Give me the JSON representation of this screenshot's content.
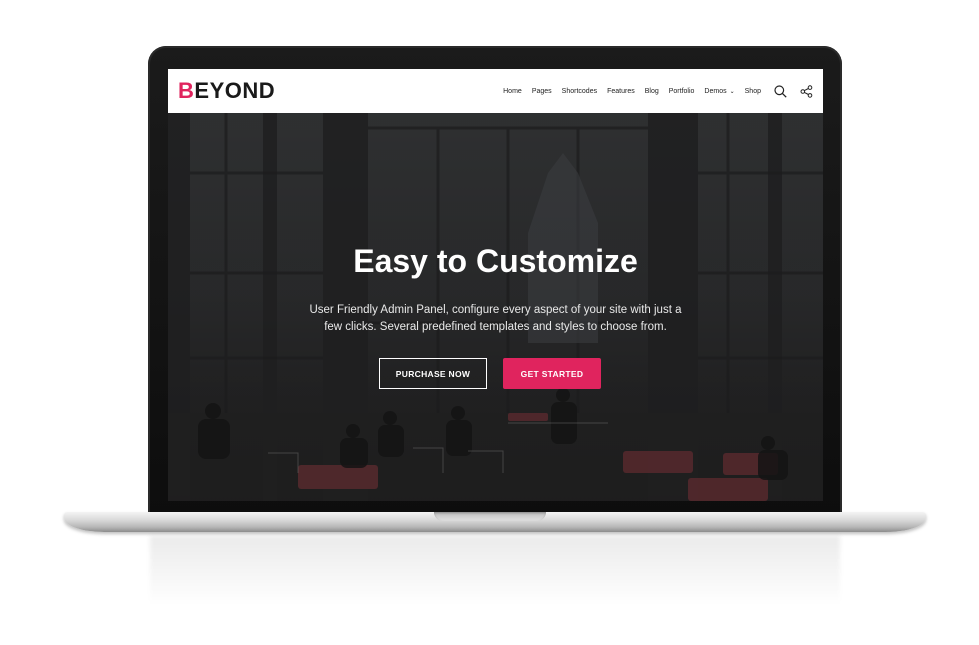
{
  "site": {
    "logo_first": "B",
    "logo_rest": "EYOND",
    "accent_color": "#e0245e"
  },
  "nav": {
    "items": [
      "Home",
      "Pages",
      "Shortcodes",
      "Features",
      "Blog",
      "Portfolio",
      "Demos",
      "Shop"
    ],
    "demos_caret": "⌄",
    "icons": [
      "search-icon",
      "share-icon"
    ]
  },
  "hero": {
    "title": "Easy to Customize",
    "subtitle": "User Friendly Admin Panel, configure every aspect of your site with just a few clicks. Several predefined templates and styles to choose from.",
    "purchase_label": "PURCHASE NOW",
    "get_started_label": "GET STARTED"
  }
}
